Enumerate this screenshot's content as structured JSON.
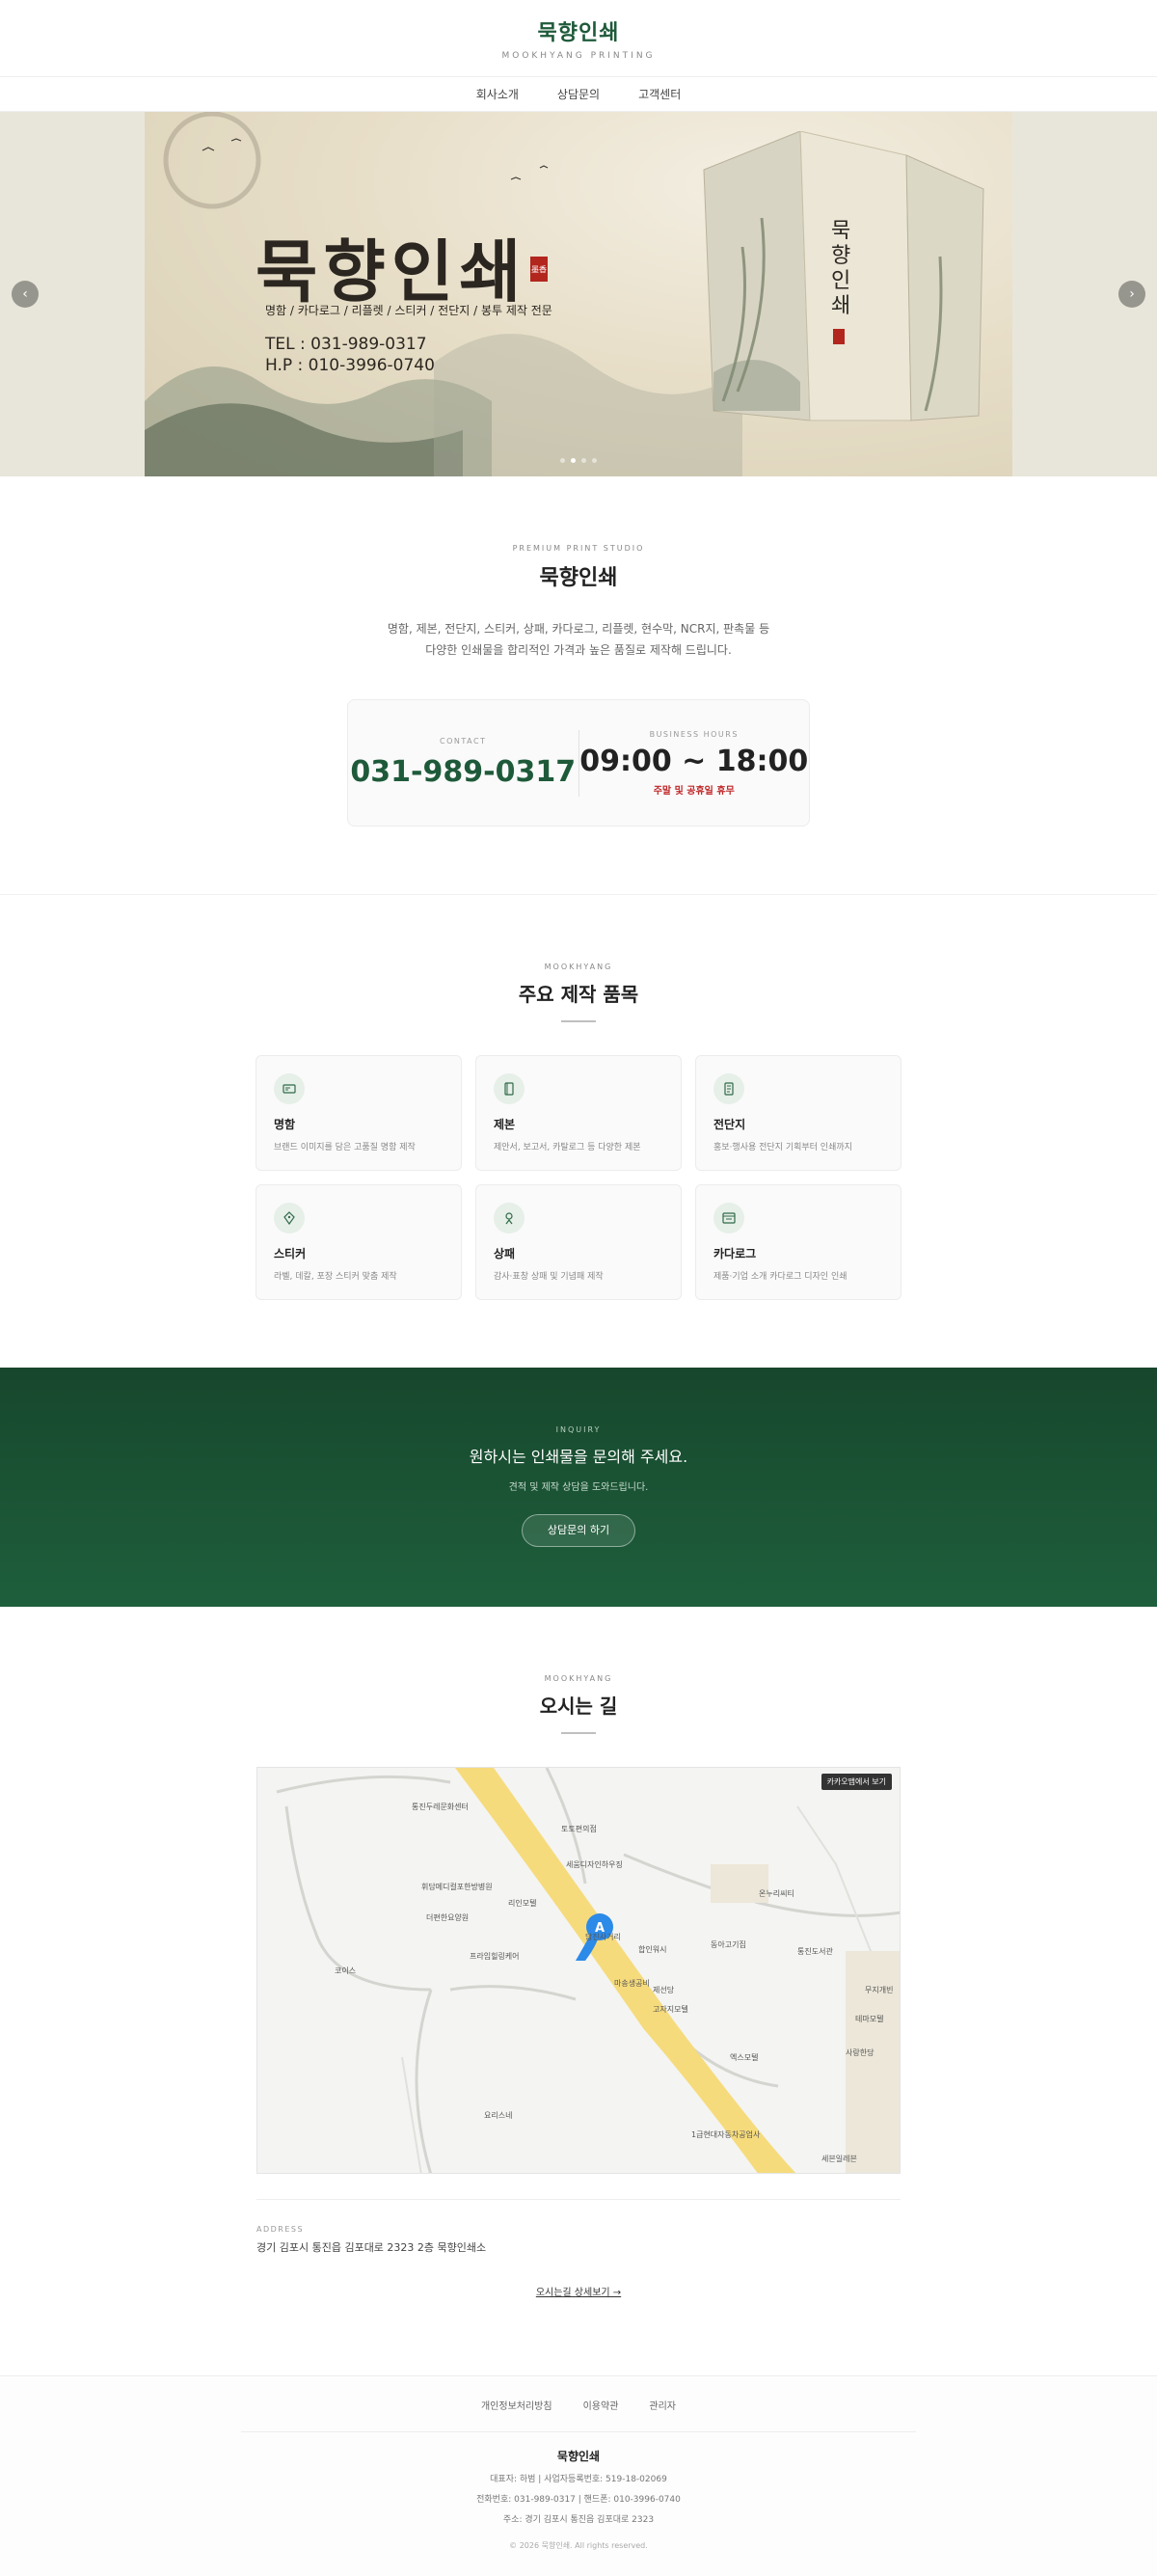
{
  "header": {
    "logo_title": "묵향인쇄",
    "logo_sub": "MOOKHYANG PRINTING"
  },
  "nav": [
    "회사소개",
    "상담문의",
    "고객센터"
  ],
  "hero": {
    "title": "묵향인쇄",
    "seal": "墨香",
    "desc": "명함 / 카다로그 / 리플렛 / 스티커 / 전단지 / 봉투 제작 전문",
    "tel": "TEL : 031-989-0317",
    "hp": "H.P : 010-3996-0740",
    "book_title": "묵향인쇄",
    "prev": "‹",
    "next": "›",
    "slide_count": 4,
    "active_slide": 2
  },
  "intro": {
    "eyebrow": "PREMIUM PRINT STUDIO",
    "title": "묵향인쇄",
    "text_line1": "명함, 제본, 전단지, 스티커, 상패, 카다로그, 리플렛, 현수막, NCR지, 판촉물 등",
    "text_line2": "다양한 인쇄물을 합리적인 가격과 높은 품질로 제작해 드립니다.",
    "contact_label": "CONTACT",
    "contact_phone": "031-989-0317",
    "hours_label": "BUSINESS HOURS",
    "hours_value": "09:00 ~ 18:00",
    "hours_note": "주말 및 공휴일 휴무"
  },
  "products": {
    "eyebrow": "MOOKHYANG",
    "title": "주요 제작 품목",
    "items": [
      {
        "name": "명함",
        "desc": "브랜드 이미지를 담은 고품질 명함 제작",
        "icon": "card-icon"
      },
      {
        "name": "제본",
        "desc": "제안서, 보고서, 카탈로그 등 다양한 제본",
        "icon": "book-icon"
      },
      {
        "name": "전단지",
        "desc": "홍보·행사용 전단지 기획부터 인쇄까지",
        "icon": "document-icon"
      },
      {
        "name": "스티커",
        "desc": "라벨, 데칼, 포장 스티커 맞춤 제작",
        "icon": "tag-icon"
      },
      {
        "name": "상패",
        "desc": "감사·표창 상패 및 기념패 제작",
        "icon": "award-icon"
      },
      {
        "name": "카다로그",
        "desc": "제품·기업 소개 카다로그 디자인 인쇄",
        "icon": "catalog-icon"
      }
    ]
  },
  "inquiry": {
    "eyebrow": "INQUIRY",
    "title": "원하시는 인쇄물을 문의해 주세요.",
    "sub": "견적 및 제작 상담을 도와드립니다.",
    "button": "상담문의 하기"
  },
  "location": {
    "eyebrow": "MOOKHYANG",
    "title": "오시는 길",
    "map_button": "카카오맵에서 보기",
    "map_labels": [
      "통진두레문화센터",
      "토토편의점",
      "세움디자인하우징",
      "휘담메디컬포한방병원",
      "리인모텔",
      "더편한요양원",
      "온누리씨티",
      "코이스",
      "프라임힐링케어",
      "합인워시",
      "동아고기집",
      "통진도서관",
      "마송생공비",
      "제선당",
      "고자지모텔",
      "무지개빈",
      "테마모텔",
      "사랑한당",
      "엑스모텔",
      "요리스네",
      "1급현대자동차공업사",
      "세븐일레븐",
      "담진사거리"
    ],
    "marker": "A",
    "address_label": "ADDRESS",
    "address": "경기 김포시 통진읍 김포대로 2323 2층 묵향인쇄소",
    "detail_link": "오시는길 상세보기 →"
  },
  "footer": {
    "links": [
      "개인정보처리방침",
      "이용약관",
      "관리자"
    ],
    "name": "묵향인쇄",
    "line1": "대표자: 하범 | 사업자등록번호: 519-18-02069",
    "line2": "전화번호: 031-989-0317 | 핸드폰: 010-3996-0740",
    "line3": "주소: 경기 김포시 통진읍 김포대로 2323",
    "copy": "© 2026 묵향인쇄. All rights reserved."
  }
}
